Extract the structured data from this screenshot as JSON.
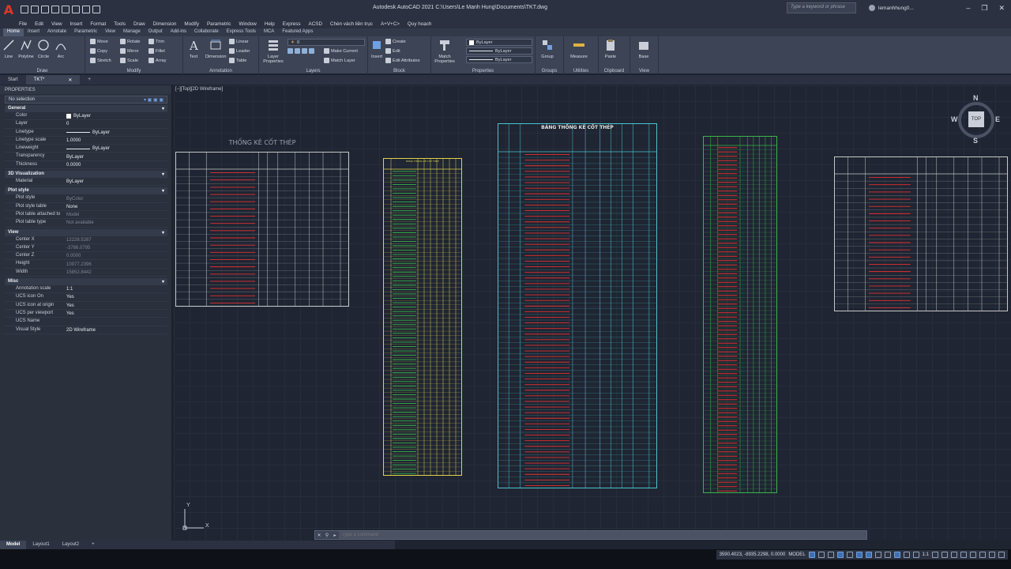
{
  "titlebar": {
    "logo": "A",
    "title": "Autodesk AutoCAD 2021    C:\\Users\\Le Manh Hung\\Documents\\TKT.dwg",
    "search_placeholder": "Type a keyword or phrase",
    "user": "lemanhhung0...",
    "controls": [
      "–",
      "❐",
      "✕"
    ]
  },
  "menu": [
    "File",
    "Edit",
    "View",
    "Insert",
    "Format",
    "Tools",
    "Draw",
    "Dimension",
    "Modify",
    "Parametric",
    "Window",
    "Help",
    "Express",
    "ACSD",
    "Chèn vách liên trục",
    "A+V+C>",
    "Quy hoạch"
  ],
  "ribbon_tabs": [
    "Home",
    "Insert",
    "Annotate",
    "Parametric",
    "View",
    "Manage",
    "Output",
    "Add-ins",
    "Collaborate",
    "Express Tools",
    "MCA",
    "Featured Apps"
  ],
  "ribbon": {
    "draw": {
      "title": "Draw",
      "tools": [
        "Line",
        "Polyline",
        "Circle",
        "Arc"
      ]
    },
    "modify": {
      "title": "Modify",
      "tools": [
        "Move",
        "Rotate",
        "Trim",
        "Copy",
        "Mirror",
        "Fillet",
        "Stretch",
        "Scale",
        "Array"
      ]
    },
    "annotation": {
      "title": "Annotation",
      "tools": [
        "Text",
        "Dimension",
        "Linear",
        "Leader",
        "Table"
      ]
    },
    "layers": {
      "title": "Layers",
      "layer_properties": "Layer Properties",
      "current_layer": "0",
      "make_current": "Make Current",
      "match_layer": "Match Layer"
    },
    "block": {
      "title": "Block",
      "insert": "Insert",
      "create": "Create",
      "edit": "Edit",
      "edit_attributes": "Edit Attributes"
    },
    "properties": {
      "title": "Properties",
      "match": "Match Properties",
      "color": "ByLayer",
      "linetype": "ByLayer",
      "lineweight": "ByLayer"
    },
    "groups": {
      "title": "Groups",
      "group": "Group"
    },
    "utilities": {
      "title": "Utilities",
      "measure": "Measure"
    },
    "clipboard": {
      "title": "Clipboard",
      "paste": "Paste"
    },
    "view": {
      "title": "View",
      "base": "Base"
    }
  },
  "filetabs": {
    "start": "Start",
    "doc": "TKT*",
    "close": "✕",
    "add": "+"
  },
  "properties_palette": {
    "header": "PROPERTIES",
    "selection": "No selection",
    "sections": [
      {
        "name": "General",
        "rows": [
          {
            "k": "Color",
            "v": "ByLayer",
            "swatch": true
          },
          {
            "k": "Layer",
            "v": "0"
          },
          {
            "k": "Linetype",
            "v": "ByLayer",
            "line": true
          },
          {
            "k": "Linetype scale",
            "v": "1.0000"
          },
          {
            "k": "Lineweight",
            "v": "ByLayer",
            "line": true
          },
          {
            "k": "Transparency",
            "v": "ByLayer"
          },
          {
            "k": "Thickness",
            "v": "0.0000"
          }
        ]
      },
      {
        "name": "3D Visualization",
        "rows": [
          {
            "k": "Material",
            "v": "ByLayer"
          }
        ]
      },
      {
        "name": "Plot style",
        "rows": [
          {
            "k": "Plot style",
            "v": "ByColor",
            "dim": true
          },
          {
            "k": "Plot style table",
            "v": "None"
          },
          {
            "k": "Plot table attached to",
            "v": "Model",
            "dim": true
          },
          {
            "k": "Plot table type",
            "v": "Not available",
            "dim": true
          }
        ]
      },
      {
        "name": "View",
        "rows": [
          {
            "k": "Center X",
            "v": "12228.5287",
            "dim": true
          },
          {
            "k": "Center Y",
            "v": "-3786.0795",
            "dim": true
          },
          {
            "k": "Center Z",
            "v": "0.0000",
            "dim": true
          },
          {
            "k": "Height",
            "v": "10977.2396",
            "dim": true
          },
          {
            "k": "Width",
            "v": "15852.8442",
            "dim": true
          }
        ]
      },
      {
        "name": "Misc",
        "rows": [
          {
            "k": "Annotation scale",
            "v": "1:1"
          },
          {
            "k": "UCS icon On",
            "v": "Yes"
          },
          {
            "k": "UCS icon at origin",
            "v": "Yes"
          },
          {
            "k": "UCS per viewport",
            "v": "Yes"
          },
          {
            "k": "UCS Name",
            "v": ""
          },
          {
            "k": "Visual Style",
            "v": "2D Wireframe"
          }
        ]
      }
    ]
  },
  "viewport_label": "[−][Top][2D Wireframe]",
  "sheets": {
    "sheet1_title": "THỐNG KÊ CỐT THÉP",
    "sheet3_title": "BẢNG THỐNG KÊ CỐT THÉP",
    "sheet2_title": "BẢNG THỐNG KÊ CỐT THÉP"
  },
  "viewcube": {
    "n": "N",
    "s": "S",
    "e": "E",
    "w": "W",
    "face": "TOP"
  },
  "ucs": {
    "x": "X",
    "y": "Y"
  },
  "command": {
    "placeholder": "Type a command"
  },
  "layout_tabs": [
    "Model",
    "Layout1",
    "Layout2",
    "+"
  ],
  "status": {
    "coords": "3590.4023, -8935.2298, 0.0000",
    "mode": "MODEL",
    "scale": "1:1"
  },
  "colors": {
    "accent": "#3f6fb0",
    "table_white": "#e6e6e6",
    "table_yellow": "#e0d24a",
    "table_cyan": "#4cc3d0",
    "table_green": "#39b54a",
    "rebar_red": "#e03030"
  }
}
